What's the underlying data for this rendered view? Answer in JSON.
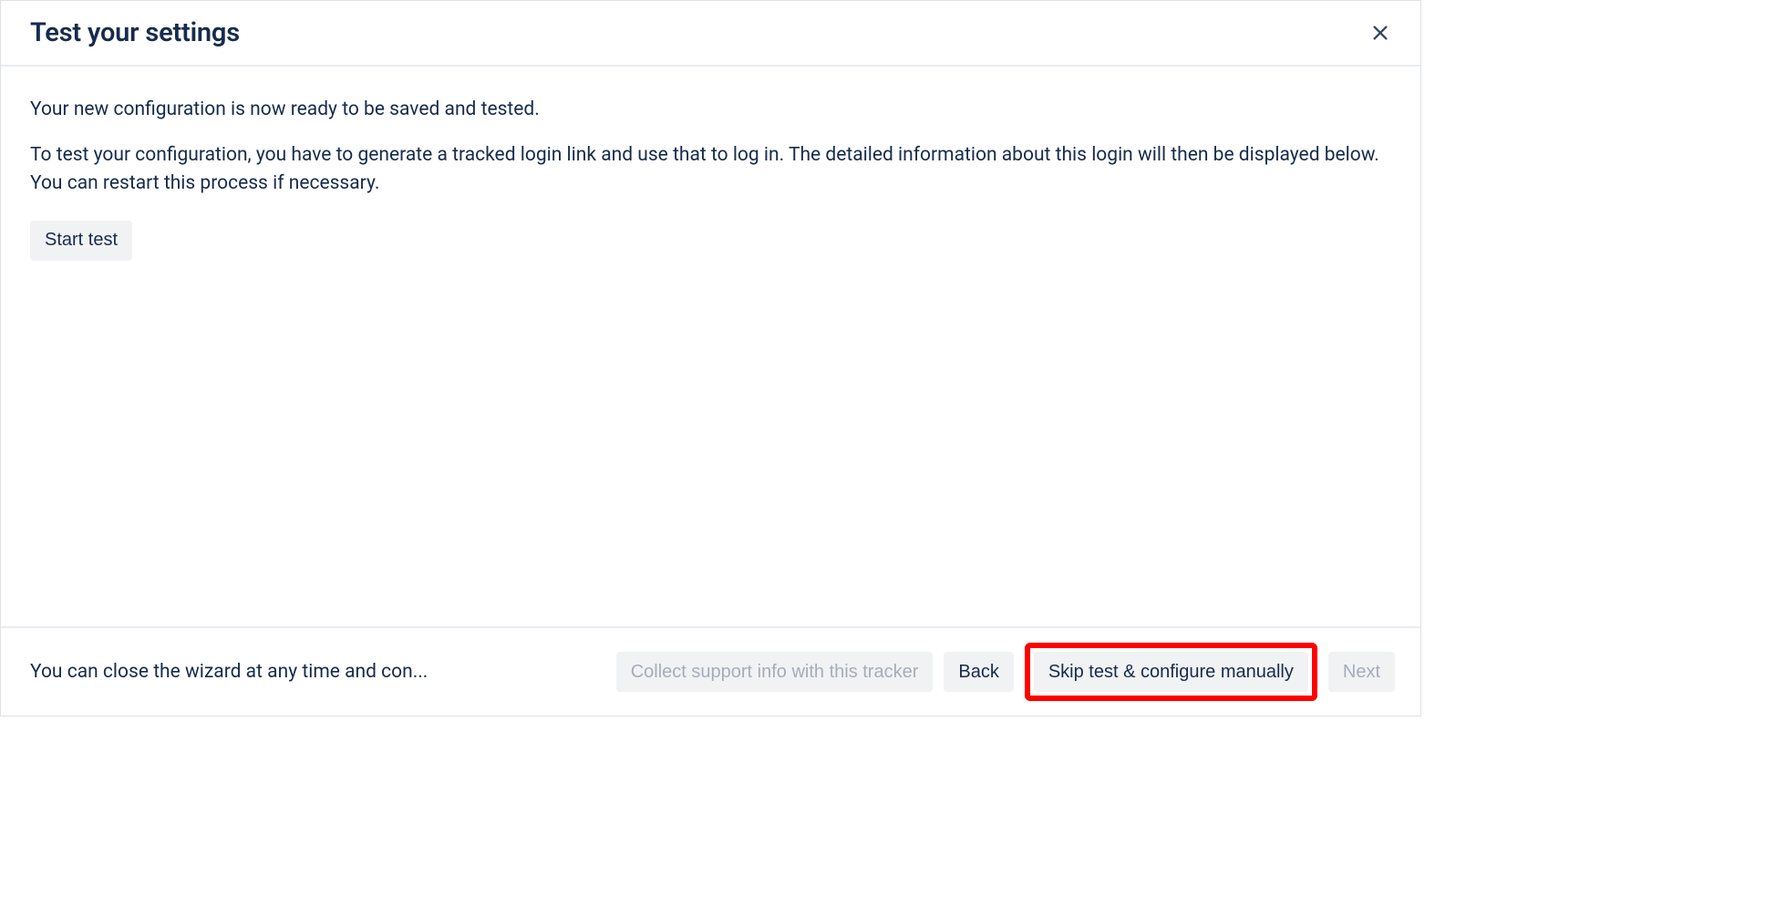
{
  "dialog": {
    "title": "Test your settings",
    "body": {
      "line1": "Your new configuration is now ready to be saved and tested.",
      "line2": "To test your configuration, you have to generate a tracked login link and use that to log in. The detailed information about this login will then be displayed below. You can restart this process if necessary.",
      "start_button": "Start test"
    },
    "footer": {
      "hint": "You can close the wizard at any time and con...",
      "collect_button": "Collect support info with this tracker",
      "back_button": "Back",
      "skip_button": "Skip test & configure manually",
      "next_button": "Next"
    }
  }
}
